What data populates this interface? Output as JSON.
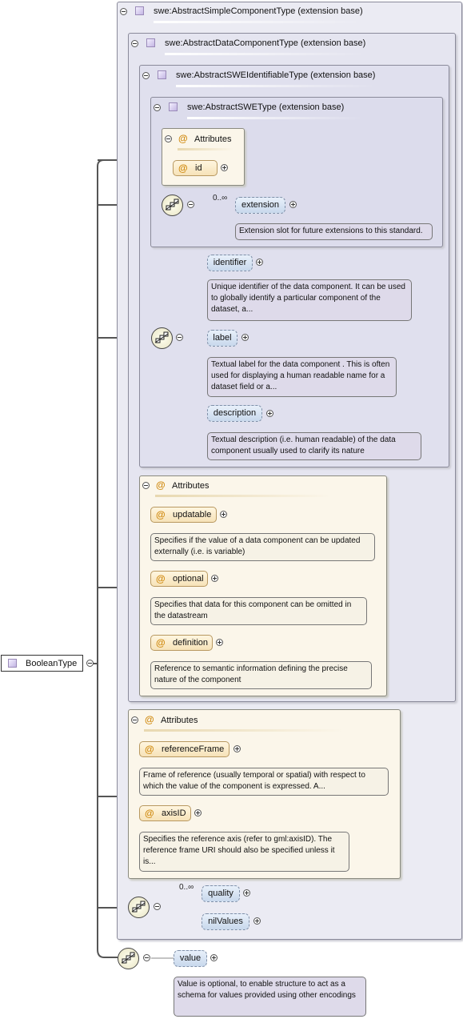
{
  "root": {
    "label": "BooleanType"
  },
  "bases": [
    {
      "label": "swe:AbstractSimpleComponentType (extension base)"
    },
    {
      "label": "swe:AbstractDataComponentType (extension base)"
    },
    {
      "label": "swe:AbstractSWEIdentifiableType (extension base)"
    },
    {
      "label": "swe:AbstractSWEType (extension base)"
    }
  ],
  "swe_type": {
    "attributes_title": "Attributes",
    "attr_id": "id",
    "extension": {
      "cardinality": "0..∞",
      "label": "extension",
      "note": "Extension slot for future extensions to this standard."
    }
  },
  "identifiable": {
    "identifier": {
      "label": "identifier",
      "note": "Unique identifier of the data component. It can be used to globally identify a particular component of the dataset, a..."
    },
    "label": {
      "label": "label",
      "note": "Textual label for the data component . This is often used for displaying a human readable name for a dataset field or a..."
    },
    "description": {
      "label": "description",
      "note": "Textual description (i.e. human readable) of the data component usually used to clarify its nature"
    }
  },
  "data_component_attrs": {
    "title": "Attributes",
    "updatable": {
      "label": "updatable",
      "note": "Specifies if the value of a data component can be updated externally (i.e. is variable)"
    },
    "optional": {
      "label": "optional",
      "note": "Specifies that data for this component can be omitted in the datastream"
    },
    "definition": {
      "label": "definition",
      "note": "Reference to semantic information defining the precise nature of the component"
    }
  },
  "simple_component_attrs": {
    "title": "Attributes",
    "referenceFrame": {
      "label": "referenceFrame",
      "note": "Frame of reference (usually temporal or spatial) with respect to which the value of the component is expressed. A..."
    },
    "axisID": {
      "label": "axisID",
      "note": "Specifies the reference axis (refer to gml:axisID). The reference frame URI should also be specified unless it is..."
    }
  },
  "simple_sequence": {
    "cardinality": "0..∞",
    "quality": "quality",
    "nilValues": "nilValues"
  },
  "value": {
    "label": "value",
    "note": "Value is optional, to enable structure to act as a schema for values provided using other encodings"
  },
  "colors": {
    "attr_at": "#d08a10",
    "element_fill": "#c8d8ec",
    "note_ann": "#dedaea",
    "attr_group": "#fbf6ea"
  }
}
